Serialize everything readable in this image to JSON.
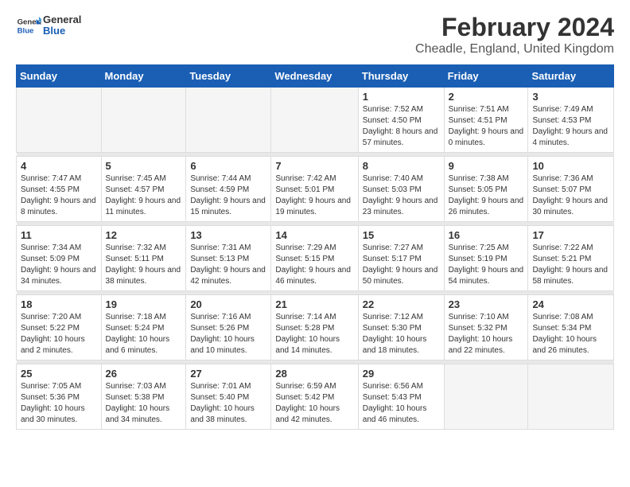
{
  "app": {
    "name_general": "General",
    "name_blue": "Blue"
  },
  "header": {
    "title": "February 2024",
    "subtitle": "Cheadle, England, United Kingdom"
  },
  "weekdays": [
    "Sunday",
    "Monday",
    "Tuesday",
    "Wednesday",
    "Thursday",
    "Friday",
    "Saturday"
  ],
  "weeks": [
    [
      {
        "day": "",
        "sunrise": "",
        "sunset": "",
        "daylight": "",
        "empty": true
      },
      {
        "day": "",
        "sunrise": "",
        "sunset": "",
        "daylight": "",
        "empty": true
      },
      {
        "day": "",
        "sunrise": "",
        "sunset": "",
        "daylight": "",
        "empty": true
      },
      {
        "day": "",
        "sunrise": "",
        "sunset": "",
        "daylight": "",
        "empty": true
      },
      {
        "day": "1",
        "sunrise": "Sunrise: 7:52 AM",
        "sunset": "Sunset: 4:50 PM",
        "daylight": "Daylight: 8 hours and 57 minutes.",
        "empty": false
      },
      {
        "day": "2",
        "sunrise": "Sunrise: 7:51 AM",
        "sunset": "Sunset: 4:51 PM",
        "daylight": "Daylight: 9 hours and 0 minutes.",
        "empty": false
      },
      {
        "day": "3",
        "sunrise": "Sunrise: 7:49 AM",
        "sunset": "Sunset: 4:53 PM",
        "daylight": "Daylight: 9 hours and 4 minutes.",
        "empty": false
      }
    ],
    [
      {
        "day": "4",
        "sunrise": "Sunrise: 7:47 AM",
        "sunset": "Sunset: 4:55 PM",
        "daylight": "Daylight: 9 hours and 8 minutes.",
        "empty": false
      },
      {
        "day": "5",
        "sunrise": "Sunrise: 7:45 AM",
        "sunset": "Sunset: 4:57 PM",
        "daylight": "Daylight: 9 hours and 11 minutes.",
        "empty": false
      },
      {
        "day": "6",
        "sunrise": "Sunrise: 7:44 AM",
        "sunset": "Sunset: 4:59 PM",
        "daylight": "Daylight: 9 hours and 15 minutes.",
        "empty": false
      },
      {
        "day": "7",
        "sunrise": "Sunrise: 7:42 AM",
        "sunset": "Sunset: 5:01 PM",
        "daylight": "Daylight: 9 hours and 19 minutes.",
        "empty": false
      },
      {
        "day": "8",
        "sunrise": "Sunrise: 7:40 AM",
        "sunset": "Sunset: 5:03 PM",
        "daylight": "Daylight: 9 hours and 23 minutes.",
        "empty": false
      },
      {
        "day": "9",
        "sunrise": "Sunrise: 7:38 AM",
        "sunset": "Sunset: 5:05 PM",
        "daylight": "Daylight: 9 hours and 26 minutes.",
        "empty": false
      },
      {
        "day": "10",
        "sunrise": "Sunrise: 7:36 AM",
        "sunset": "Sunset: 5:07 PM",
        "daylight": "Daylight: 9 hours and 30 minutes.",
        "empty": false
      }
    ],
    [
      {
        "day": "11",
        "sunrise": "Sunrise: 7:34 AM",
        "sunset": "Sunset: 5:09 PM",
        "daylight": "Daylight: 9 hours and 34 minutes.",
        "empty": false
      },
      {
        "day": "12",
        "sunrise": "Sunrise: 7:32 AM",
        "sunset": "Sunset: 5:11 PM",
        "daylight": "Daylight: 9 hours and 38 minutes.",
        "empty": false
      },
      {
        "day": "13",
        "sunrise": "Sunrise: 7:31 AM",
        "sunset": "Sunset: 5:13 PM",
        "daylight": "Daylight: 9 hours and 42 minutes.",
        "empty": false
      },
      {
        "day": "14",
        "sunrise": "Sunrise: 7:29 AM",
        "sunset": "Sunset: 5:15 PM",
        "daylight": "Daylight: 9 hours and 46 minutes.",
        "empty": false
      },
      {
        "day": "15",
        "sunrise": "Sunrise: 7:27 AM",
        "sunset": "Sunset: 5:17 PM",
        "daylight": "Daylight: 9 hours and 50 minutes.",
        "empty": false
      },
      {
        "day": "16",
        "sunrise": "Sunrise: 7:25 AM",
        "sunset": "Sunset: 5:19 PM",
        "daylight": "Daylight: 9 hours and 54 minutes.",
        "empty": false
      },
      {
        "day": "17",
        "sunrise": "Sunrise: 7:22 AM",
        "sunset": "Sunset: 5:21 PM",
        "daylight": "Daylight: 9 hours and 58 minutes.",
        "empty": false
      }
    ],
    [
      {
        "day": "18",
        "sunrise": "Sunrise: 7:20 AM",
        "sunset": "Sunset: 5:22 PM",
        "daylight": "Daylight: 10 hours and 2 minutes.",
        "empty": false
      },
      {
        "day": "19",
        "sunrise": "Sunrise: 7:18 AM",
        "sunset": "Sunset: 5:24 PM",
        "daylight": "Daylight: 10 hours and 6 minutes.",
        "empty": false
      },
      {
        "day": "20",
        "sunrise": "Sunrise: 7:16 AM",
        "sunset": "Sunset: 5:26 PM",
        "daylight": "Daylight: 10 hours and 10 minutes.",
        "empty": false
      },
      {
        "day": "21",
        "sunrise": "Sunrise: 7:14 AM",
        "sunset": "Sunset: 5:28 PM",
        "daylight": "Daylight: 10 hours and 14 minutes.",
        "empty": false
      },
      {
        "day": "22",
        "sunrise": "Sunrise: 7:12 AM",
        "sunset": "Sunset: 5:30 PM",
        "daylight": "Daylight: 10 hours and 18 minutes.",
        "empty": false
      },
      {
        "day": "23",
        "sunrise": "Sunrise: 7:10 AM",
        "sunset": "Sunset: 5:32 PM",
        "daylight": "Daylight: 10 hours and 22 minutes.",
        "empty": false
      },
      {
        "day": "24",
        "sunrise": "Sunrise: 7:08 AM",
        "sunset": "Sunset: 5:34 PM",
        "daylight": "Daylight: 10 hours and 26 minutes.",
        "empty": false
      }
    ],
    [
      {
        "day": "25",
        "sunrise": "Sunrise: 7:05 AM",
        "sunset": "Sunset: 5:36 PM",
        "daylight": "Daylight: 10 hours and 30 minutes.",
        "empty": false
      },
      {
        "day": "26",
        "sunrise": "Sunrise: 7:03 AM",
        "sunset": "Sunset: 5:38 PM",
        "daylight": "Daylight: 10 hours and 34 minutes.",
        "empty": false
      },
      {
        "day": "27",
        "sunrise": "Sunrise: 7:01 AM",
        "sunset": "Sunset: 5:40 PM",
        "daylight": "Daylight: 10 hours and 38 minutes.",
        "empty": false
      },
      {
        "day": "28",
        "sunrise": "Sunrise: 6:59 AM",
        "sunset": "Sunset: 5:42 PM",
        "daylight": "Daylight: 10 hours and 42 minutes.",
        "empty": false
      },
      {
        "day": "29",
        "sunrise": "Sunrise: 6:56 AM",
        "sunset": "Sunset: 5:43 PM",
        "daylight": "Daylight: 10 hours and 46 minutes.",
        "empty": false
      },
      {
        "day": "",
        "sunrise": "",
        "sunset": "",
        "daylight": "",
        "empty": true
      },
      {
        "day": "",
        "sunrise": "",
        "sunset": "",
        "daylight": "",
        "empty": true
      }
    ]
  ]
}
